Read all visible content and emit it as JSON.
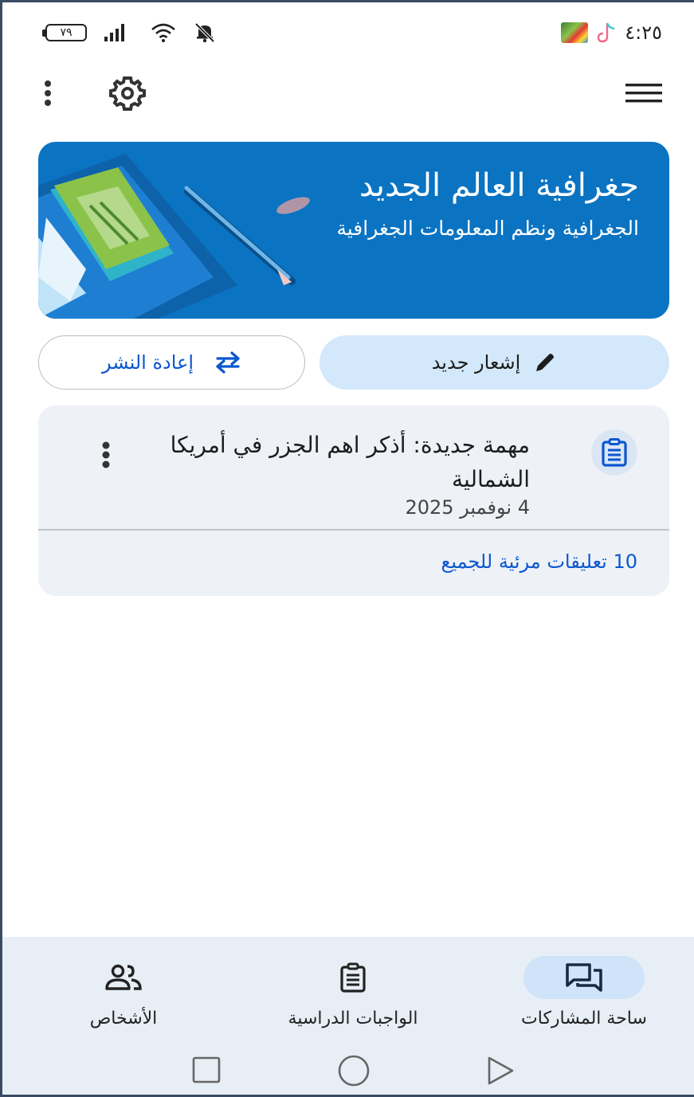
{
  "status_bar": {
    "battery": "٧٩",
    "time": "٤:٢٥",
    "icons": [
      "battery-icon",
      "signal-icon",
      "wifi-icon",
      "notifications-off-icon",
      "gallery-thumbnail-icon",
      "tiktok-icon"
    ]
  },
  "top_bar": {
    "icons": [
      "more-vert-icon",
      "settings-gear-icon",
      "hamburger-menu-icon"
    ]
  },
  "course_banner": {
    "title": "جغرافية العالم الجديد",
    "subtitle": "الجغرافية ونظم المعلومات الجغرافية",
    "background_color": "#0a73c2"
  },
  "actions": {
    "new_announcement_label": "إشعار جديد",
    "repost_label": "إعادة النشر"
  },
  "post": {
    "title": "مهمة جديدة: أذكر اهم الجزر في أمريكا الشمالية",
    "date": "4 نوفمبر 2025",
    "comments_label": "10 تعليقات مرئية للجميع"
  },
  "bottom_nav": {
    "items": [
      {
        "label": "ساحة المشاركات",
        "icon": "forum-icon",
        "active": true
      },
      {
        "label": "الواجبات الدراسية",
        "icon": "assignment-icon",
        "active": false
      },
      {
        "label": "الأشخاص",
        "icon": "people-icon",
        "active": false
      }
    ]
  },
  "system_nav": [
    "back-icon",
    "home-icon",
    "recents-icon"
  ],
  "colors": {
    "accent": "#0b57d0",
    "banner": "#0a73c2",
    "announce_button": "#d3e8fb",
    "card_bg": "#eef2f7",
    "nav_bg": "#e8eef6"
  }
}
